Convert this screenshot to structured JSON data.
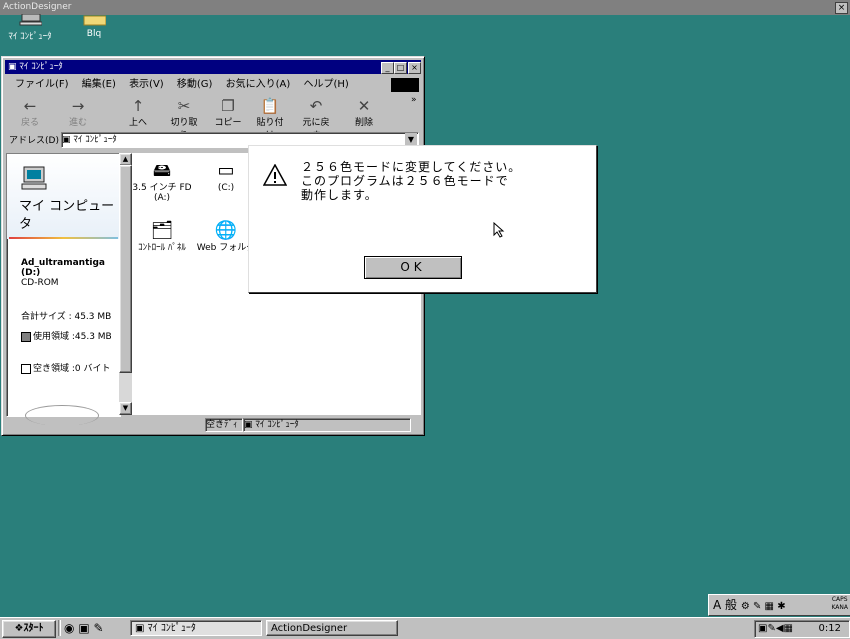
{
  "outer_window": {
    "title": "ActionDesigner"
  },
  "desktop_icons": [
    {
      "label": "ﾏｲ ｺﾝﾋﾟｭｰﾀ",
      "icon": "computer-icon"
    },
    {
      "label": "Blq",
      "icon": "folder-icon"
    }
  ],
  "explorer": {
    "title": "ﾏｲ ｺﾝﾋﾟｭｰﾀ",
    "menu": [
      "ファイル(F)",
      "編集(E)",
      "表示(V)",
      "移動(G)",
      "お気に入り(A)",
      "ヘルプ(H)"
    ],
    "toolbar": [
      "戻る",
      "進む",
      "上へ",
      "切り取り",
      "コピー",
      "貼り付け",
      "元に戻す",
      "削除"
    ],
    "address_label": "アドレス(D)",
    "address_value": "ﾏｲ ｺﾝﾋﾟｭｰﾀ",
    "left_pane": {
      "heading": "マイ コンピュータ",
      "drive_name": "Ad_ultramantiga (D:)",
      "drive_type": "CD-ROM",
      "total": "合計サイズ : 45.3 MB",
      "used": "使用領域 :45.3 MB",
      "free": "空き領域 :0 バイト"
    },
    "items": [
      {
        "label": "3.5 インチ FD (A:)",
        "icon": "floppy-icon"
      },
      {
        "label": "(C:)",
        "icon": "hard-drive-icon"
      },
      {
        "label": "ｺﾝﾄﾛｰﾙ ﾊﾟﾈﾙ",
        "icon": "control-panel-icon"
      },
      {
        "label": "Web フォルダ",
        "icon": "web-folder-icon"
      }
    ],
    "status_left": "空きﾃﾞｨ",
    "status_right": "ﾏｲ ｺﾝﾋﾟｭｰﾀ"
  },
  "dialog": {
    "message": "２５６色モードに変更してください。\nこのプログラムは２５６色モードで\n動作します。",
    "ok_label": "OK"
  },
  "ime_panel": {
    "text": "A 般"
  },
  "taskbar": {
    "start_label": "ｽﾀｰﾄ",
    "tasks": [
      "ﾏｲ ｺﾝﾋﾟｭｰﾀ",
      "ActionDesigner"
    ],
    "clock": "0:12"
  }
}
